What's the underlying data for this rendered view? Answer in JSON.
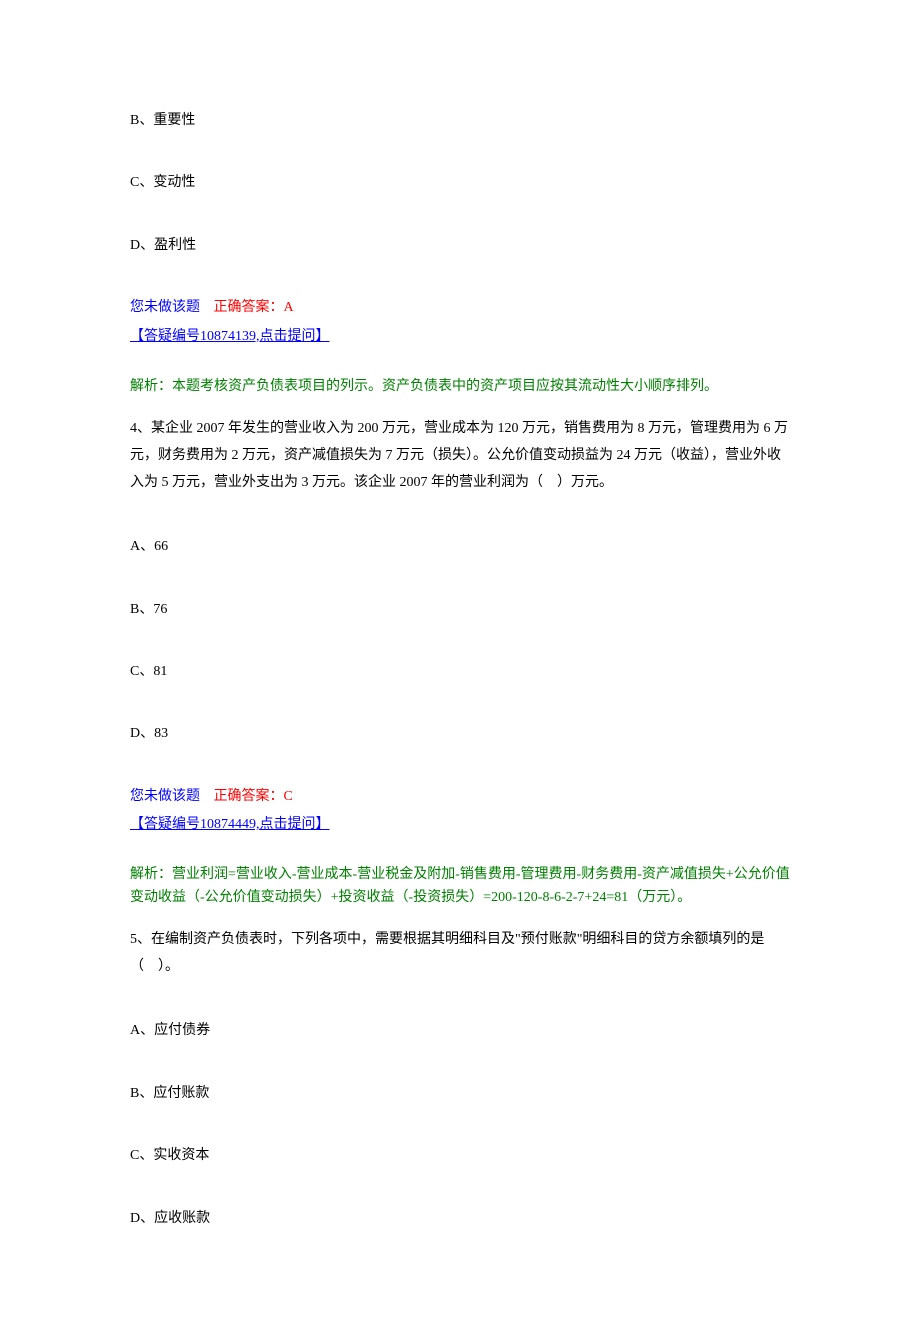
{
  "q3_tail_options": {
    "B": "B、重要性",
    "C": "C、变动性",
    "D": "D、盈利性"
  },
  "q3_status": {
    "not_done": "您未做该题",
    "correct": "正确答案：A"
  },
  "q3_qa_link": "【答疑编号10874139,点击提问】",
  "q3_analysis_label": "解析：",
  "q3_analysis_text": "本题考核资产负债表项目的列示。资产负债表中的资产项目应按其流动性大小顺序排列。",
  "q4_stem": "4、某企业 2007 年发生的营业收入为 200 万元，营业成本为 120 万元，销售费用为 8 万元，管理费用为 6 万元，财务费用为 2 万元，资产减值损失为 7 万元（损失）。公允价值变动损益为 24 万元（收益），营业外收入为 5 万元，营业外支出为 3 万元。该企业 2007 年的营业利润为（　）万元。",
  "q4_options": {
    "A": "A、66",
    "B": "B、76",
    "C": "C、81",
    "D": "D、83"
  },
  "q4_status": {
    "not_done": "您未做该题",
    "correct": "正确答案：C"
  },
  "q4_qa_link": "【答疑编号10874449,点击提问】",
  "q4_analysis_label": "解析：",
  "q4_analysis_text": "营业利润=营业收入-营业成本-营业税金及附加-销售费用-管理费用-财务费用-资产减值损失+公允价值变动收益（-公允价值变动损失）+投资收益（-投资损失）=200-120-8-6-2-7+24=81（万元）。",
  "q5_stem": "5、在编制资产负债表时，下列各项中，需要根据其明细科目及\"预付账款\"明细科目的贷方余额填列的是（　）。",
  "q5_options": {
    "A": "A、应付债券",
    "B": "B、应付账款",
    "C": "C、实收资本",
    "D": "D、应收账款"
  }
}
